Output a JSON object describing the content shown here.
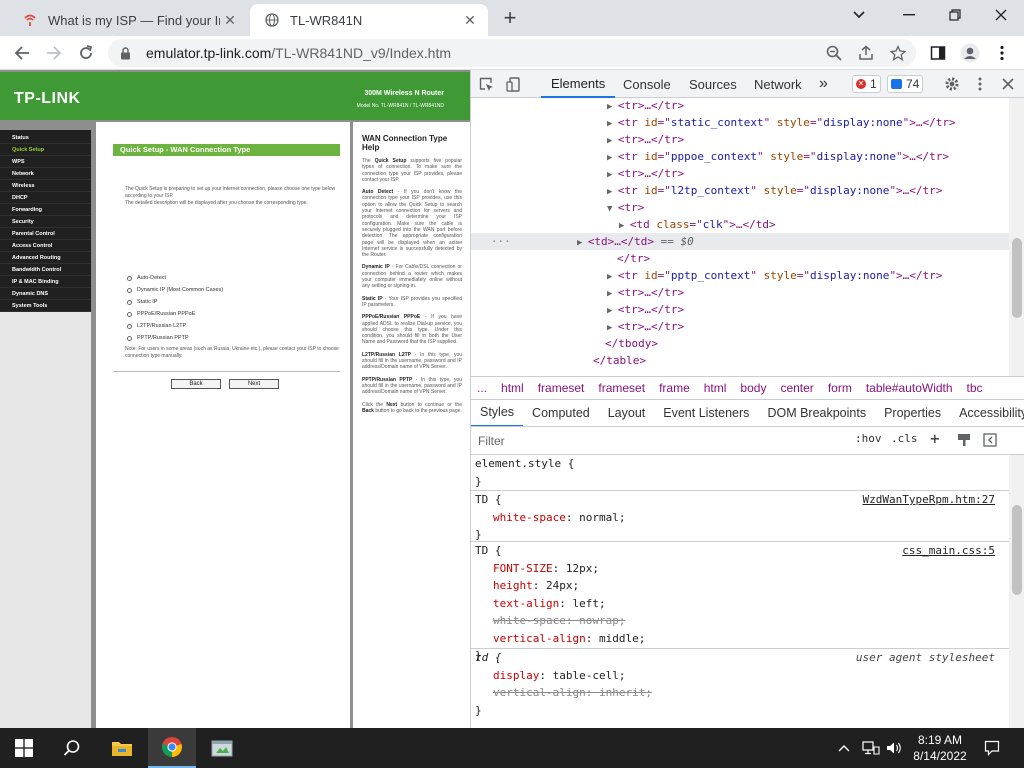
{
  "browser": {
    "tabs": [
      {
        "title": "What is my ISP — Find your Inter",
        "active": false
      },
      {
        "title": "TL-WR841N",
        "active": true
      }
    ],
    "url_host": "emulator.tp-link.com",
    "url_path": "/TL-WR841ND_v9/Index.htm"
  },
  "router": {
    "logo": "TP-LINK",
    "product_name": "300M Wireless N Router",
    "model_no": "Model No. TL-WR841N / TL-WR841ND",
    "menu": [
      {
        "label": "Status",
        "selected": false
      },
      {
        "label": "Quick Setup",
        "selected": true
      },
      {
        "label": "WPS",
        "selected": false
      },
      {
        "label": "Network",
        "selected": false
      },
      {
        "label": "Wireless",
        "selected": false
      },
      {
        "label": "DHCP",
        "selected": false
      },
      {
        "label": "Forwarding",
        "selected": false
      },
      {
        "label": "Security",
        "selected": false
      },
      {
        "label": "Parental Control",
        "selected": false
      },
      {
        "label": "Access Control",
        "selected": false
      },
      {
        "label": "Advanced Routing",
        "selected": false
      },
      {
        "label": "Bandwidth Control",
        "selected": false
      },
      {
        "label": "IP & MAC Binding",
        "selected": false
      },
      {
        "label": "Dynamic DNS",
        "selected": false
      },
      {
        "label": "System Tools",
        "selected": false
      }
    ],
    "section_title": "Quick Setup - WAN Connection Type",
    "intro_1": "The Quick Setup is preparing to set up your internet connection, please choose one type below according to your ISP.",
    "intro_2": "The detailed description will be displayed after you choose the corresponding type.",
    "options": [
      "Auto-Detect",
      "Dynamic IP (Most Common Cases)",
      "Static IP",
      "PPPoE/Russian PPPoE",
      "L2TP/Russian L2TP",
      "PPTP/Russian PPTP"
    ],
    "note": "Note: For users in some areas (such as Russia, Ukraine etc.), please contact your ISP to choose connection type manually.",
    "back_label": "Back",
    "next_label": "Next",
    "help": {
      "title": "WAN Connection Type Help",
      "p1_lead": "The ",
      "p1_bold": "Quick Setup",
      "p1_rest": " supports five popular types of connection. To make sure the connection type your ISP provides, please contact your ISP.",
      "p2_bold": "Auto Detect",
      "p2_rest": " - If you don't know the connection type your ISP provides, use this option to allow the Quick Setup to search your Internet connection for servers and protocols and determine your ISP configuration. Make sure the cable is securely plugged into the WAN port before detection. The appropriate configuration page will be displayed when an active Internet service is successfully detected by the Router.",
      "p3_bold": "Dynamic IP",
      "p3_rest": " - For Cable/DSL connection or connection behind a router which makes your computer immediately online without any setting or signing-in.",
      "p4_bold": "Static IP",
      "p4_rest": " - Your ISP provides you specified IP parameters.",
      "p5_bold": "PPPoE/Russian PPPoE",
      "p5_rest": " - If you have applied ADSL to realize Dial-up service, you should choose this type. Under this condition, you should fill in both the User Name and Password that the ISP supplied.",
      "p6_bold": "L2TP/Russian L2TP",
      "p6_rest": " - In this type, you should fill in the username, password and IP address/Domain name of VPN Server.",
      "p7_bold": "PPTP/Russian PPTP",
      "p7_rest": " - In this type, you should fill in the username, password and IP address/Domain name of VPN Server.",
      "p8_a": "Click the ",
      "p8_b": "Next",
      "p8_c": " button to continue or the ",
      "p8_d": "Back",
      "p8_e": " button to go back to the previous page."
    }
  },
  "devtools": {
    "tabs": [
      "Elements",
      "Console",
      "Sources",
      "Network"
    ],
    "more": "»",
    "error_count": "1",
    "message_count": "74",
    "breadcrumbs": [
      "...",
      "html",
      "frameset",
      "frameset",
      "frame",
      "html",
      "body",
      "center",
      "form",
      "table#autoWidth",
      "tbc"
    ],
    "subtabs": [
      "Styles",
      "Computed",
      "Layout",
      "Event Listeners",
      "DOM Breakpoints",
      "Properties",
      "Accessibility"
    ],
    "filter_placeholder": "Filter",
    "hov": ":hov",
    "cls": ".cls",
    "dom": {
      "l1": "<tr>…</tr>",
      "l2_id": "static_context",
      "l3": "<tr>…</tr>",
      "l4_id": "pppoe_context",
      "l5": "<tr>…</tr>",
      "l6_id": "l2tp_context",
      "l7": "<tr>",
      "l8_class": "clk",
      "l9": "<td>…</td>",
      "l9_eq": " == $0",
      "l10": "</tr>",
      "l11_id": "pptp_context",
      "l12": "<tr>…</tr>",
      "l13": "<tr>…</tr>",
      "l14": "<tr>…</tr>",
      "l15": "</tbody>",
      "l16": "</table>",
      "style_none": "display:none"
    },
    "styles": {
      "element_style": "element.style {",
      "r1_selector": "TD {",
      "r1_source": "WzdWanTypeRpm.htm:27",
      "r1_prop": "white-space",
      "r1_val": "normal;",
      "r2_selector": "TD {",
      "r2_source": "css_main.css:5",
      "r2_props": [
        {
          "name": "FONT-SIZE",
          "value": "12px;",
          "struck": false
        },
        {
          "name": "height",
          "value": "24px;",
          "struck": false
        },
        {
          "name": "text-align",
          "value": "left;",
          "struck": false
        },
        {
          "name": "white-space",
          "value": "nowrap;",
          "struck": true
        },
        {
          "name": "vertical-align",
          "value": "middle;",
          "struck": false
        }
      ],
      "r3_selector": "td {",
      "r3_source": "user agent stylesheet",
      "r3_props": [
        {
          "name": "display",
          "value": "table-cell;",
          "struck": false
        },
        {
          "name": "vertical-align",
          "value": "inherit;",
          "struck": true
        }
      ],
      "close": "}"
    }
  },
  "taskbar": {
    "time": "8:19 AM",
    "date": "8/14/2022"
  }
}
